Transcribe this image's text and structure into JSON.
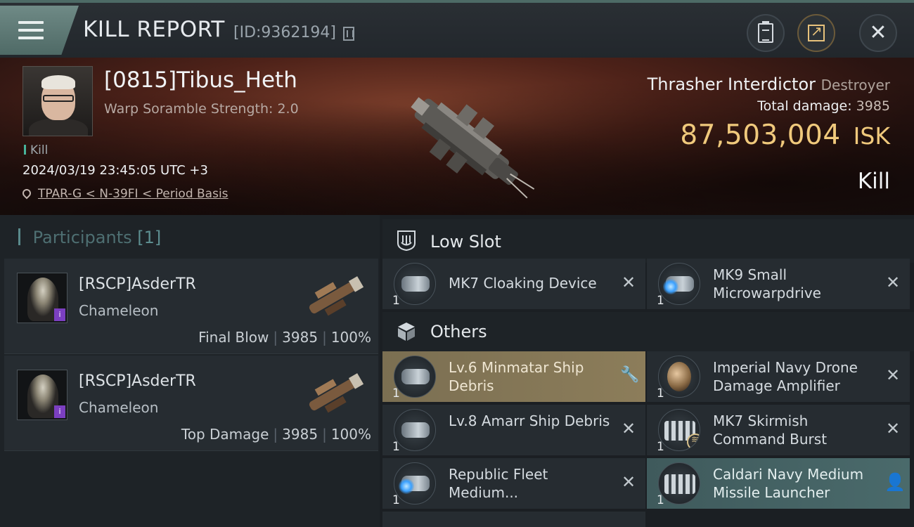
{
  "header": {
    "title": "KILL REPORT",
    "report_id": "[ID:9362194]",
    "icons": {
      "menu": "hamburger-menu-icon",
      "copy": "copy-icon",
      "clipboard": "clipboard-icon",
      "share": "share-icon",
      "close": "close-icon"
    }
  },
  "victim": {
    "name": "[0815]Tibus_Heth",
    "subtitle": "Warp Soramble Strength: 2.0",
    "kill_tag": "Kill",
    "timestamp": "2024/03/19 23:45:05 UTC +3",
    "location": "TPAR-G < N-39FI < Period Basis",
    "ship_name": "Thrasher Interdictor",
    "ship_class": "Destroyer",
    "total_damage_label": "Total damage:",
    "total_damage": "3985",
    "isk_value": "87,503,004",
    "isk_unit": "ISK",
    "result": "Kill"
  },
  "participants": {
    "header": "Participants",
    "count": "[1]",
    "rows": [
      {
        "name": "[RSCP]AsderTR",
        "ship": "Chameleon",
        "role": "Final Blow",
        "damage": "3985",
        "percent": "100%",
        "badge": "i",
        "sep": "|"
      },
      {
        "name": "[RSCP]AsderTR",
        "ship": "Chameleon",
        "role": "Top Damage",
        "damage": "3985",
        "percent": "100%",
        "badge": "i",
        "sep": "|"
      }
    ]
  },
  "sections": {
    "low_slot": {
      "title": "Low Slot",
      "items": [
        {
          "qty": "1",
          "name": "MK7 Cloaking Device",
          "action": "✕"
        },
        {
          "qty": "1",
          "name": "MK9 Small Microwarpdrive",
          "action": "✕"
        }
      ]
    },
    "others": {
      "title": "Others",
      "items": [
        {
          "qty": "1",
          "name": "Lv.6 Minmatar Ship Debris",
          "action": "🔧"
        },
        {
          "qty": "1",
          "name": "Imperial Navy Drone Damage Amplifier",
          "action": "✕"
        },
        {
          "qty": "1",
          "name": "Lv.8 Amarr Ship Debris",
          "action": "✕"
        },
        {
          "qty": "1",
          "name": "MK7 Skirmish Command Burst",
          "action": "✕"
        },
        {
          "qty": "1",
          "name": "Republic Fleet Medium...",
          "action": "✕"
        },
        {
          "qty": "1",
          "name": "Caldari Navy Medium Missile Launcher",
          "action": "👤"
        }
      ]
    }
  },
  "colors": {
    "accent_teal": "#4f6a66",
    "isk_gold": "#f0c97c",
    "highlight_gold": "#8c7d5a",
    "highlight_teal": "#4a6a6b"
  }
}
